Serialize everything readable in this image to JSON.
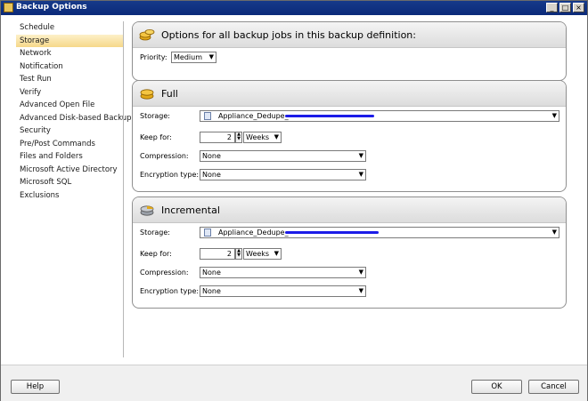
{
  "window": {
    "title": "Backup Options"
  },
  "nav": {
    "items": [
      {
        "label": "Schedule"
      },
      {
        "label": "Storage",
        "active": true
      },
      {
        "label": "Network"
      },
      {
        "label": "Notification"
      },
      {
        "label": "Test Run"
      },
      {
        "label": "Verify"
      },
      {
        "label": "Advanced Open File"
      },
      {
        "label": "Advanced Disk-based Backup"
      },
      {
        "label": "Security"
      },
      {
        "label": "Pre/Post Commands"
      },
      {
        "label": "Files and Folders"
      },
      {
        "label": "Microsoft Active Directory"
      },
      {
        "label": "Microsoft SQL"
      },
      {
        "label": "Exclusions"
      }
    ]
  },
  "options_panel": {
    "title": "Options for all backup jobs in this backup definition:",
    "priority_label": "Priority:",
    "priority_value": "Medium"
  },
  "full": {
    "title": "Full",
    "storage_label": "Storage:",
    "storage_value": "Appliance_Dedupe_",
    "keep_for_label": "Keep for:",
    "keep_for_value": "2",
    "keep_for_unit": "Weeks",
    "compression_label": "Compression:",
    "compression_value": "None",
    "encryption_label": "Encryption type:",
    "encryption_value": "None"
  },
  "incremental": {
    "title": "Incremental",
    "storage_label": "Storage:",
    "storage_value": "Appliance_Dedupe_",
    "keep_for_label": "Keep for:",
    "keep_for_value": "2",
    "keep_for_unit": "Weeks",
    "compression_label": "Compression:",
    "compression_value": "None",
    "encryption_label": "Encryption type:",
    "encryption_value": "None"
  },
  "buttons": {
    "help": "Help",
    "ok": "OK",
    "cancel": "Cancel"
  },
  "colors": {
    "title_bar": "#0b2a7a",
    "nav_active": "#f6d88a",
    "redaction": "#1c1ce8"
  }
}
